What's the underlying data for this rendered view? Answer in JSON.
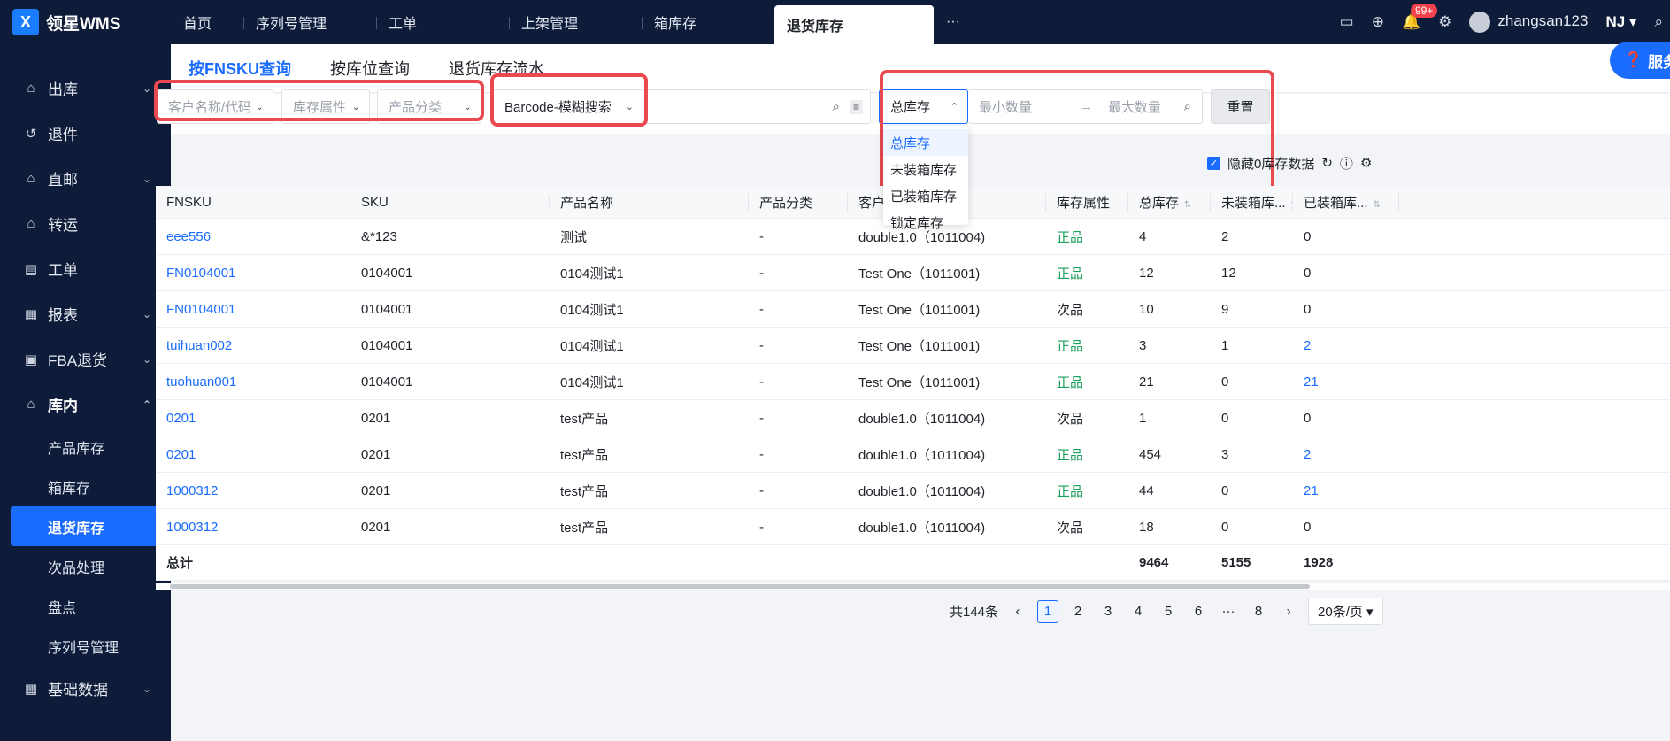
{
  "app": {
    "logo_letter": "X",
    "name": "领星WMS"
  },
  "top_tabs": [
    "首页",
    "序列号管理",
    "工单",
    "上架管理",
    "箱库存",
    "退货库存"
  ],
  "top_tab_active": "退货库存",
  "top_more": "···",
  "top_right": {
    "badge": "99+",
    "username": "zhangsan123",
    "lang": "NJ ▾"
  },
  "sidebar": {
    "items": [
      {
        "label": "出库",
        "icon": "outbound-icon"
      },
      {
        "label": "退件",
        "icon": "return-icon"
      },
      {
        "label": "直邮",
        "icon": "direct-mail-icon"
      },
      {
        "label": "转运",
        "icon": "transfer-icon"
      },
      {
        "label": "工单",
        "icon": "workorder-icon"
      },
      {
        "label": "报表",
        "icon": "report-icon"
      },
      {
        "label": "FBA退货",
        "icon": "fba-icon"
      },
      {
        "label": "库内",
        "icon": "warehouse-icon"
      }
    ],
    "sub_items": [
      "产品库存",
      "箱库存",
      "退货库存",
      "次品处理",
      "盘点",
      "序列号管理"
    ],
    "bottom_item": "基础数据"
  },
  "sub_tabs": [
    "按FNSKU查询",
    "按库位查询",
    "退货库存流水"
  ],
  "filters": {
    "customer_placeholder": "客户名称/代码",
    "attr_placeholder": "库存属性",
    "category_placeholder": "产品分类",
    "search_mode": "Barcode-模糊搜索",
    "stock_type": "总库存",
    "min_placeholder": "最小数量",
    "max_placeholder": "最大数量",
    "reset": "重置",
    "service": "服务"
  },
  "dropdown_options": [
    "总库存",
    "未装箱库存",
    "已装箱库存",
    "锁定库存"
  ],
  "toolbar": {
    "hide_zero": "隐藏0库存数据"
  },
  "table": {
    "headers": [
      "FNSKU",
      "SKU",
      "产品名称",
      "产品分类",
      "客户",
      "库存属性",
      "总库存",
      "未装箱库...",
      "已装箱库..."
    ],
    "rows": [
      [
        "eee556",
        "&*123_",
        "测试",
        "-",
        "double1.0（1011004)",
        "正品",
        "4",
        "2",
        "0"
      ],
      [
        "FN0104001",
        "0104001",
        "0104测试1",
        "-",
        "Test One（1011001)",
        "正品",
        "12",
        "12",
        "0"
      ],
      [
        "FN0104001",
        "0104001",
        "0104测试1",
        "-",
        "Test One（1011001)",
        "次品",
        "10",
        "9",
        "0"
      ],
      [
        "tuihuan002",
        "0104001",
        "0104测试1",
        "-",
        "Test One（1011001)",
        "正品",
        "3",
        "1",
        "2"
      ],
      [
        "tuohuan001",
        "0104001",
        "0104测试1",
        "-",
        "Test One（1011001)",
        "正品",
        "21",
        "0",
        "21"
      ],
      [
        "0201",
        "0201",
        "test产品",
        "-",
        "double1.0（1011004)",
        "次品",
        "1",
        "0",
        "0"
      ],
      [
        "0201",
        "0201",
        "test产品",
        "-",
        "double1.0（1011004)",
        "正品",
        "454",
        "3",
        "2"
      ],
      [
        "1000312",
        "0201",
        "test产品",
        "-",
        "double1.0（1011004)",
        "正品",
        "44",
        "0",
        "21"
      ],
      [
        "1000312",
        "0201",
        "test产品",
        "-",
        "double1.0（1011004)",
        "次品",
        "18",
        "0",
        "0"
      ]
    ],
    "total": {
      "label": "总计",
      "total": "9464",
      "unboxed": "5155",
      "boxed": "1928"
    }
  },
  "pager": {
    "total": "共144条",
    "pages": [
      "1",
      "2",
      "3",
      "4",
      "5",
      "6",
      "···",
      "8"
    ],
    "page_size": "20条/页 ▾"
  },
  "colors": {
    "accent": "#1a6cff",
    "sidebar": "#0e1c3a",
    "good": "#19a05a",
    "highlight": "#e84a4f"
  }
}
